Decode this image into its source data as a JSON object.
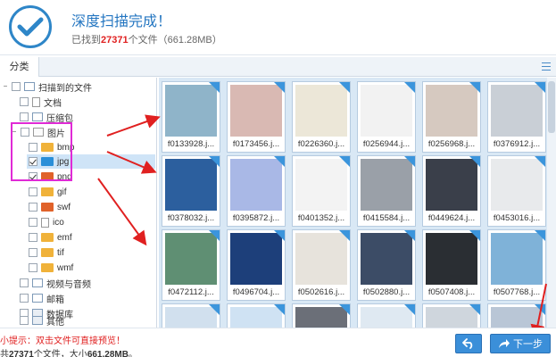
{
  "header": {
    "title": "深度扫描完成！",
    "found_prefix": "已找到",
    "found_count": "27371",
    "found_suffix": "个文件（661.28MB）"
  },
  "tabs": {
    "classify": "分类"
  },
  "tree": {
    "root": "扫描到的文件",
    "documents": "文档",
    "archives": "压缩包",
    "images": "图片",
    "bmp": "bmp",
    "jpg": "jpg",
    "png": "png",
    "gif": "gif",
    "swf": "swf",
    "ico": "ico",
    "emf": "emf",
    "tif": "tif",
    "wmf": "wmf",
    "video_audio": "视频与音频",
    "email": "邮箱",
    "database": "数据库",
    "other": "其他"
  },
  "thumbnails": [
    {
      "name": "f0133928.j...",
      "color": "#8fb4c9"
    },
    {
      "name": "f0173456.j...",
      "color": "#d9b9b3"
    },
    {
      "name": "f0226360.j...",
      "color": "#ece7d8"
    },
    {
      "name": "f0256944.j...",
      "color": "#f2f2f2"
    },
    {
      "name": "f0256968.j...",
      "color": "#d6c9c0"
    },
    {
      "name": "f0376912.j...",
      "color": "#c9cfd6"
    },
    {
      "name": "f0378032.j...",
      "color": "#2c5f9e"
    },
    {
      "name": "f0395872.j...",
      "color": "#a9b8e6"
    },
    {
      "name": "f0401352.j...",
      "color": "#f3f3f3"
    },
    {
      "name": "f0415584.j...",
      "color": "#9aa0a8"
    },
    {
      "name": "f0449624.j...",
      "color": "#3a3f4a"
    },
    {
      "name": "f0453016.j...",
      "color": "#e8eaec"
    },
    {
      "name": "f0472112.j...",
      "color": "#5f8f73"
    },
    {
      "name": "f0496704.j...",
      "color": "#1d3f7a"
    },
    {
      "name": "f0502616.j...",
      "color": "#e7e3dc"
    },
    {
      "name": "f0502880.j...",
      "color": "#3c4c66"
    },
    {
      "name": "f0507408.j...",
      "color": "#2a2e33"
    },
    {
      "name": "f0507768.j...",
      "color": "#7fb2d8"
    },
    {
      "name": "",
      "color": "#d1e0ee"
    },
    {
      "name": "",
      "color": "#cfe2f3"
    },
    {
      "name": "",
      "color": "#6b6f78"
    },
    {
      "name": "",
      "color": "#dfe9f2"
    },
    {
      "name": "",
      "color": "#cfd6dd"
    },
    {
      "name": "",
      "color": "#b9c6d6"
    }
  ],
  "footer": {
    "tip": "小提示：双击文件可直接预览！",
    "summary_prefix": "共",
    "summary_count": "27371",
    "summary_mid": "个文件，大小",
    "summary_size": "661.28MB",
    "summary_suffix": "。",
    "next_label": "下一步"
  },
  "colors": {
    "accent": "#2e86c8",
    "highlight": "#e02ad6",
    "arrow": "#e02020"
  }
}
